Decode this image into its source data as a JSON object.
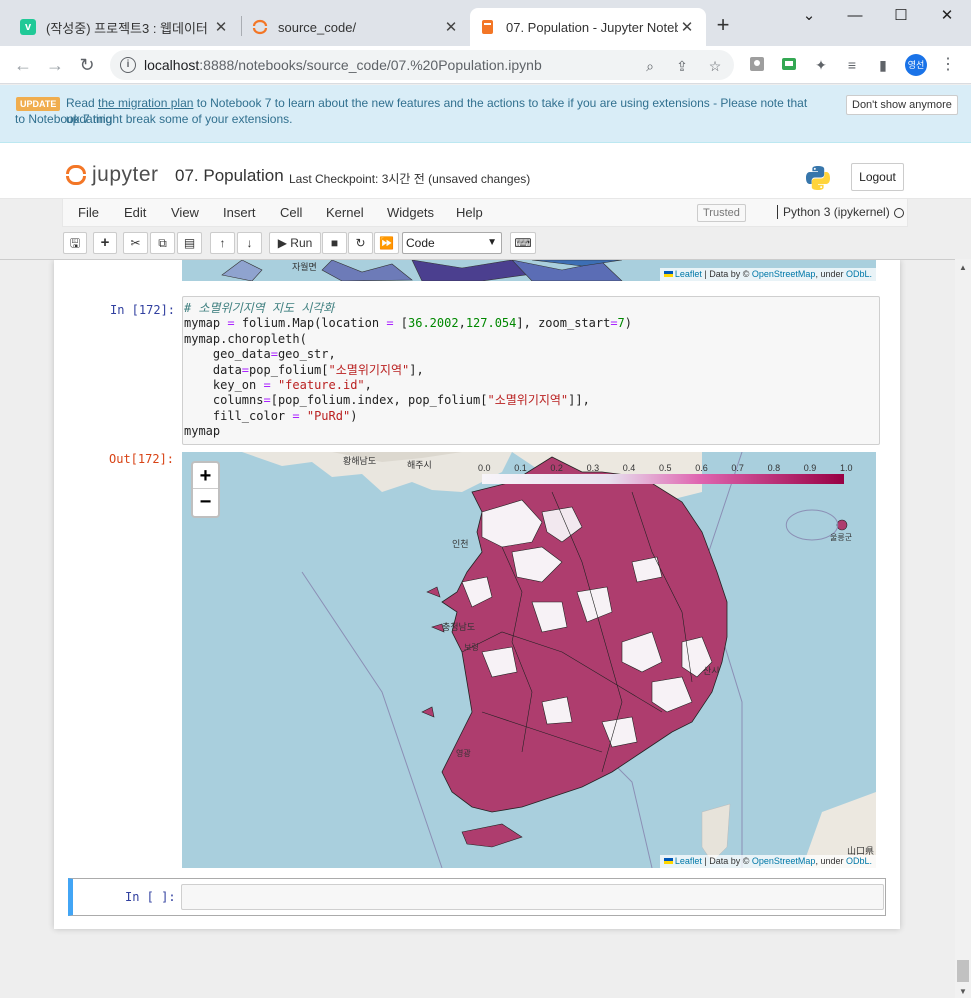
{
  "browser": {
    "tabs": [
      {
        "label": "(작성중) 프로젝트3 : 웹데이터",
        "favicon": "v",
        "favicon_color": "#20c997",
        "active": false
      },
      {
        "label": "source_code/",
        "favicon": "jupyter-icon",
        "favicon_color": "#f37626",
        "active": false
      },
      {
        "label": "07. Population - Jupyter Noteb",
        "favicon": "notebook-icon",
        "favicon_color": "#f37626",
        "active": true
      }
    ],
    "url_host": "localhost",
    "url_path": ":8888/notebooks/source_code/07.%20Population.ipynb",
    "profile_label": "영선"
  },
  "banner": {
    "badge": "UPDATE",
    "text_before_link": "Read ",
    "link_text": "the migration plan",
    "text_after_link": " to Notebook 7 to learn about the new features and the actions to take if you are using extensions - Please note that updating",
    "text_line2": "to Notebook 7 might break some of your extensions.",
    "dismiss_label": "Don't show anymore"
  },
  "header": {
    "logo_text": "jupyter",
    "notebook_title": "07. Population",
    "checkpoint": "Last Checkpoint: 3시간 전   (unsaved changes)",
    "logout_label": "Logout"
  },
  "menubar": {
    "items": [
      "File",
      "Edit",
      "View",
      "Insert",
      "Cell",
      "Kernel",
      "Widgets",
      "Help"
    ],
    "trusted_label": "Trusted",
    "kernel_label": "Python 3 (ipykernel)"
  },
  "toolbar": {
    "run_label": "Run",
    "cell_type": "Code"
  },
  "cell": {
    "in_prompt": "In [172]:",
    "out_prompt": "Out[172]:",
    "code": {
      "l1": "# 소멸위기지역 지도 시각화",
      "l2a": "mymap ",
      "l2b": "=",
      "l2c": " folium.Map(location ",
      "l2d": "=",
      "l2e": " [",
      "l2f": "36.2002",
      "l2g": ",",
      "l2h": "127.054",
      "l2i": "], zoom_start",
      "l2j": "=",
      "l2k": "7",
      "l2l": ")",
      "l3": "mymap.choropleth(",
      "l4a": "    geo_data",
      "l4b": "=",
      "l4c": "geo_str,",
      "l5a": "    data",
      "l5b": "=",
      "l5c": "pop_folium[",
      "l5d": "\"소멸위기지역\"",
      "l5e": "],",
      "l6a": "    key_on ",
      "l6b": "=",
      "l6c": " ",
      "l6d": "\"feature.id\"",
      "l6e": ",",
      "l7a": "    columns",
      "l7b": "=",
      "l7c": "[pop_folium.index, pop_folium[",
      "l7d": "\"소멸위기지역\"",
      "l7e": "]],",
      "l8a": "    fill_color ",
      "l8b": "=",
      "l8c": " ",
      "l8d": "\"PuRd\"",
      "l8e": ")",
      "l9": "mymap"
    },
    "map": {
      "legend_ticks": [
        "0.0",
        "0.1",
        "0.2",
        "0.3",
        "0.4",
        "0.5",
        "0.6",
        "0.7",
        "0.8",
        "0.9",
        "1.0"
      ],
      "fill_high": "#ae3d6e",
      "fill_low": "#f7f2f6",
      "sea_color": "#a9cfdd",
      "place_labels": [
        "황해남도",
        "해주시",
        "인천",
        "충청남도",
        "보령",
        "영광",
        "울릉군",
        "산시",
        "山口県"
      ],
      "zoom_in": "+",
      "zoom_out": "−",
      "attribution": {
        "leaflet": "Leaflet",
        "mid": " | Data by © ",
        "osm": "OpenStreetMap",
        "under": ", under ",
        "odbl": "ODbL."
      }
    },
    "prev_map_labels": [
      "자월면"
    ]
  },
  "empty_cell": {
    "in_prompt": "In [ ]:"
  }
}
